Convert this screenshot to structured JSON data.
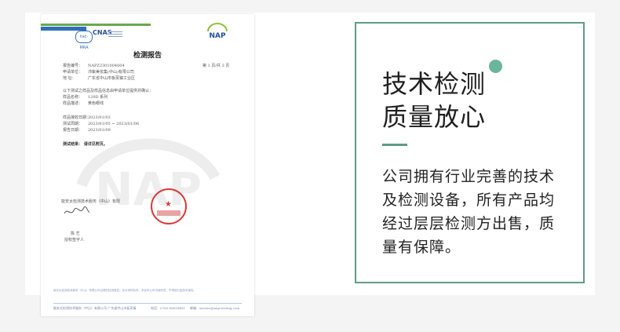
{
  "colors": {
    "accent": "#5f9b86",
    "dot": "#6bb59a",
    "seal_red": "#d93a3a",
    "doc_green": "#6aa84f",
    "doc_blue": "#2f6fb7"
  },
  "certificate": {
    "logos": {
      "ilac": "ilac-MRA",
      "cnas": "CNAS",
      "nap": "NAP"
    },
    "title": "检测报告",
    "report_no_label": "报告编号：",
    "report_no": "NAPZ2301004604",
    "page_info": "第 1 页/共 3 页",
    "applicant_label": "申请单位：",
    "applicant": "沛紫美妆集(中山)有限公司",
    "address_label": "地  址：",
    "address": "广东省中山市板芙镇工业区",
    "intro": "以下测试之样品及样品信息由申请单位提供并确认：",
    "sample_name_label": "样品名称：",
    "sample_name": "120D 系列",
    "sample_desc_label": "样品描述：",
    "sample_desc": "黄色眼线",
    "received_label": "样品接收日期：",
    "received": "2023/01/03",
    "test_period_label": "测试周期：",
    "test_period": "2023/01/05 ~ 2023/01/06",
    "report_date_label": "报告日期：",
    "report_date": "2023/01/09",
    "result_label": "测试结果：",
    "result": "请详见附页。",
    "signer_org": "能安太检测技术服务（中山）有限",
    "signer_name": "陈 艺",
    "signer_title": "授权签字人",
    "seal_text": "检验检测专用章",
    "footer_note": "能安太检测技术服务（中山）有限公司出具的检测报告，仅对来样负责。未经本公司书面同意，不得部分复制本报告。",
    "footer_addr": "能安太检测技术服务（中山）有限公司 广东省中山市板芙镇",
    "footer_tel": "电话：0760-88818481",
    "footer_mail": "邮箱：service@nap-testing.com"
  },
  "card": {
    "heading_line1": "技术检测",
    "heading_line2": "质量放心",
    "body_lines": [
      "公司拥有行业完善的技术",
      "及检测设备，所有产品均",
      "经过层层检测方出售，质",
      "量有保障。"
    ]
  }
}
